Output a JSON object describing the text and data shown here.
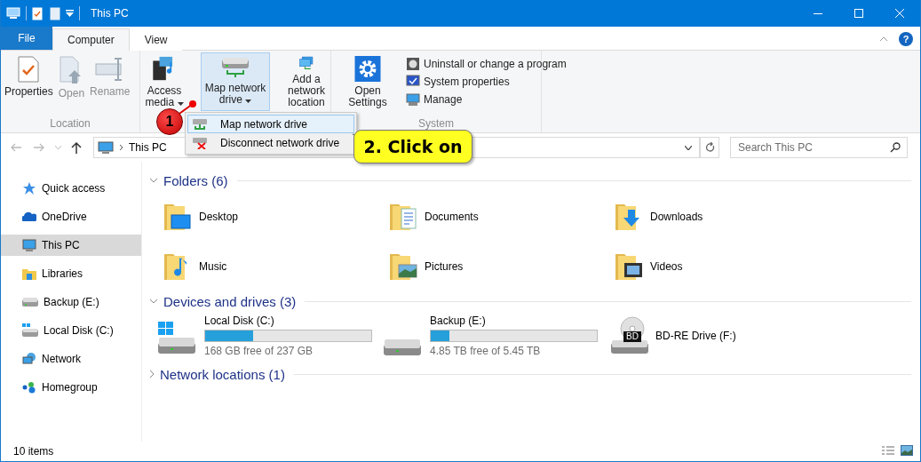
{
  "window": {
    "title": "This PC"
  },
  "ribbon_tabs": [
    {
      "label": "File",
      "selected": false,
      "kind": "file"
    },
    {
      "label": "Computer",
      "selected": true,
      "kind": "tab"
    },
    {
      "label": "View",
      "selected": false,
      "kind": "tab"
    }
  ],
  "help_button": "?",
  "ribbon_groups": [
    {
      "label": "Location",
      "buttons": [
        {
          "label": "Properties",
          "disabled": false,
          "has_menu": false,
          "selected": false
        },
        {
          "label": "Open",
          "disabled": true,
          "has_menu": false,
          "selected": false
        },
        {
          "label": "Rename",
          "disabled": true,
          "has_menu": false,
          "selected": false
        }
      ]
    },
    {
      "buttons": [
        {
          "label": "Access media",
          "disabled": false,
          "has_menu": true,
          "selected": false
        },
        {
          "label": "Map network drive",
          "disabled": false,
          "has_menu": true,
          "selected": true
        },
        {
          "label": "Add a network location",
          "disabled": false,
          "has_menu": false,
          "selected": false
        }
      ]
    },
    {
      "label": "System",
      "buttons": [
        {
          "label": "Open Settings",
          "disabled": false,
          "has_menu": false,
          "selected": false
        }
      ],
      "small_buttons": [
        "Uninstall or change a program",
        "System properties",
        "Manage"
      ]
    }
  ],
  "dropdown_menu": [
    {
      "label": "Map network drive",
      "selected": true
    },
    {
      "label": "Disconnect network drive",
      "selected": false
    }
  ],
  "address_bar": {
    "path": "This PC"
  },
  "search": {
    "placeholder": "Search This PC"
  },
  "sidebar": {
    "items": [
      {
        "label": "Quick access",
        "selected": false
      },
      {
        "label": "OneDrive",
        "selected": false
      },
      {
        "label": "This PC",
        "selected": true
      },
      {
        "label": "Libraries",
        "selected": false
      },
      {
        "label": "Backup (E:)",
        "selected": false
      },
      {
        "label": "Local Disk (C:)",
        "selected": false
      },
      {
        "label": "Network",
        "selected": false
      },
      {
        "label": "Homegroup",
        "selected": false
      }
    ]
  },
  "sections": [
    {
      "title": "Folders (6)",
      "expanded": true,
      "kind": "folders",
      "items": [
        {
          "name": "Desktop"
        },
        {
          "name": "Documents"
        },
        {
          "name": "Downloads"
        },
        {
          "name": "Music"
        },
        {
          "name": "Pictures"
        },
        {
          "name": "Videos"
        }
      ]
    },
    {
      "title": "Devices and drives (3)",
      "expanded": true,
      "kind": "drives",
      "items": [
        {
          "name": "Local Disk (C:)",
          "kind": "disk",
          "level": 0.29,
          "free": "168 GB free of 237 GB"
        },
        {
          "name": "Backup (E:)",
          "kind": "disk",
          "level": 0.11,
          "free": "4.85 TB free of 5.45 TB"
        },
        {
          "name": "BD-RE Drive (F:)",
          "kind": "optical",
          "badge": "BD"
        }
      ]
    },
    {
      "title": "Network locations (1)",
      "expanded": false,
      "kind": "network"
    }
  ],
  "status_bar": {
    "text": "10 items"
  },
  "annotations": [
    {
      "kind": "marker",
      "text": "1"
    },
    {
      "kind": "callout",
      "text": "2. Click on"
    }
  ]
}
